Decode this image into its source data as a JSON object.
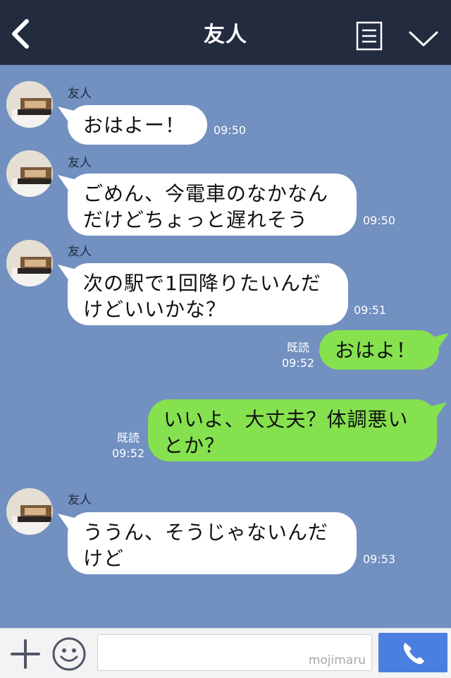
{
  "header": {
    "title": "友人",
    "back_icon": "chevron-left-icon",
    "menu_icon": "list-icon",
    "collapse_icon": "chevron-down-icon",
    "background": "#232b3f"
  },
  "chat": {
    "background": "#7290c0",
    "messages": [
      {
        "direction": "incoming",
        "sender": "友人",
        "lines": [
          "おはよー！"
        ],
        "time": "09:50"
      },
      {
        "direction": "incoming",
        "sender": "友人",
        "lines": [
          "ごめん、今電車のなかなん",
          "だけどちょっと遅れそう"
        ],
        "time": "09:50"
      },
      {
        "direction": "incoming",
        "sender": "友人",
        "lines": [
          "次の駅で1回降りたいんだ",
          "けどいいかな？"
        ],
        "time": "09:51"
      },
      {
        "direction": "outgoing",
        "read": "既読",
        "lines": [
          "おはよ！"
        ],
        "time": "09:52"
      },
      {
        "direction": "outgoing",
        "read": "既読",
        "lines": [
          "いいよ、大丈夫？体調悪い",
          "とか？"
        ],
        "time": "09:52"
      },
      {
        "direction": "incoming",
        "sender": "友人",
        "lines": [
          "ううん、そうじゃないんだ",
          "けど"
        ],
        "time": "09:53"
      }
    ],
    "incoming_bubble_color": "#ffffff",
    "outgoing_bubble_color": "#85e14e"
  },
  "footer": {
    "plus_icon": "plus-icon",
    "emoji_icon": "smiley-icon",
    "input_value": "",
    "watermark": "mojimaru",
    "call_icon": "phone-icon",
    "call_color": "#4a7fe0"
  }
}
